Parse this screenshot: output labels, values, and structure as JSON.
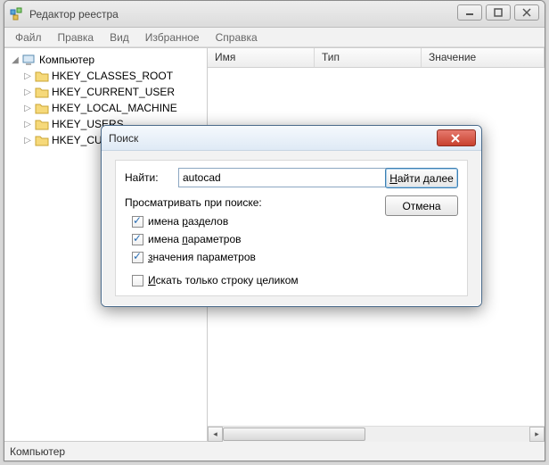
{
  "window": {
    "title": "Редактор реестра"
  },
  "menu": {
    "file": "Файл",
    "edit": "Правка",
    "view": "Вид",
    "favorites": "Избранное",
    "help": "Справка"
  },
  "tree": {
    "root": "Компьютер",
    "items": [
      "HKEY_CLASSES_ROOT",
      "HKEY_CURRENT_USER",
      "HKEY_LOCAL_MACHINE",
      "HKEY_USERS",
      "HKEY_CURRENT_CONFIG"
    ]
  },
  "list": {
    "col_name": "Имя",
    "col_type": "Тип",
    "col_value": "Значение"
  },
  "statusbar": "Компьютер",
  "dialog": {
    "title": "Поиск",
    "find_label": "Найти:",
    "find_value": "autocad",
    "btn_find_prefix": "Н",
    "btn_find_rest": "айти далее",
    "btn_cancel": "Отмена",
    "group_label": "Просматривать при поиске:",
    "chk_keys_pre": "имена ",
    "chk_keys_u": "р",
    "chk_keys_post": "азделов",
    "chk_values_pre": "имена ",
    "chk_values_u": "п",
    "chk_values_post": "араметров",
    "chk_data_u": "з",
    "chk_data_post": "начения параметров",
    "chk_whole_u": "И",
    "chk_whole_post": "скать только строку целиком"
  }
}
